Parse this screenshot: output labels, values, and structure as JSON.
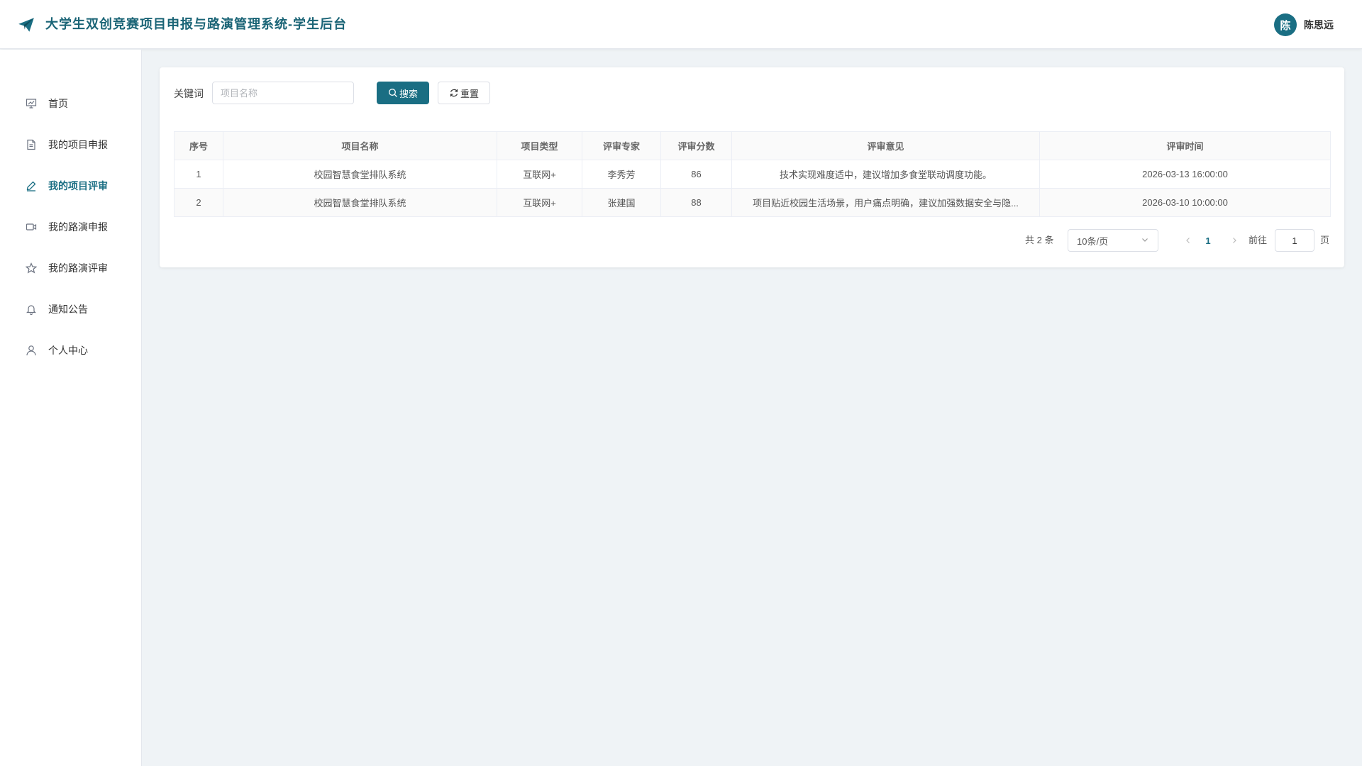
{
  "header": {
    "title": "大学生双创竞赛项目申报与路演管理系统-学生后台",
    "user": {
      "avatar_text": "陈",
      "name": "陈思远"
    }
  },
  "sidebar": {
    "items": [
      {
        "label": "首页",
        "icon": "presentation-icon",
        "active": false
      },
      {
        "label": "我的项目申报",
        "icon": "document-icon",
        "active": false
      },
      {
        "label": "我的项目评审",
        "icon": "pen-icon",
        "active": true
      },
      {
        "label": "我的路演申报",
        "icon": "video-camera-icon",
        "active": false
      },
      {
        "label": "我的路演评审",
        "icon": "star-icon",
        "active": false
      },
      {
        "label": "通知公告",
        "icon": "bell-icon",
        "active": false
      },
      {
        "label": "个人中心",
        "icon": "user-icon",
        "active": false
      }
    ]
  },
  "search": {
    "label": "关键词",
    "placeholder": "项目名称",
    "value": "",
    "search_button": "搜索",
    "reset_button": "重置"
  },
  "table": {
    "columns": [
      "序号",
      "项目名称",
      "项目类型",
      "评审专家",
      "评审分数",
      "评审意见",
      "评审时间"
    ],
    "rows": [
      [
        "1",
        "校园智慧食堂排队系统",
        "互联网+",
        "李秀芳",
        "86",
        "技术实现难度适中，建议增加多食堂联动调度功能。",
        "2026-03-13 16:00:00"
      ],
      [
        "2",
        "校园智慧食堂排队系统",
        "互联网+",
        "张建国",
        "88",
        "项目贴近校园生活场景，用户痛点明确，建议加强数据安全与隐...",
        "2026-03-10 10:00:00"
      ]
    ]
  },
  "pagination": {
    "total_text": "共 2 条",
    "page_size": "10条/页",
    "current_page": "1",
    "goto_label": "前往",
    "goto_value": "1",
    "goto_suffix": "页"
  },
  "colors": {
    "primary": "#1a6e83",
    "title": "#1a6476",
    "background": "#eff3f6"
  }
}
